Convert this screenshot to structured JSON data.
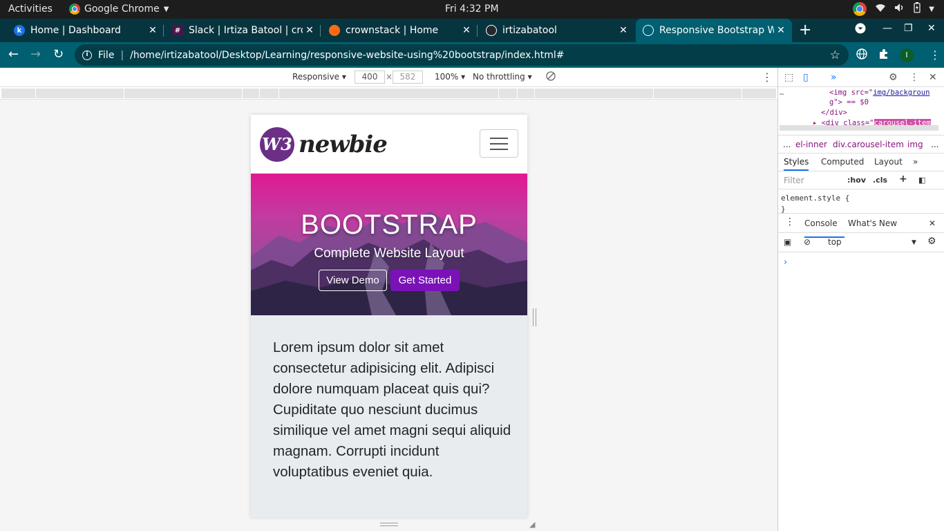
{
  "system": {
    "activities": "Activities",
    "app_name": "Google Chrome",
    "clock": "Fri  4:32 PM"
  },
  "tabs": [
    {
      "title": "Home | Dashboard",
      "favicon_letter": "k",
      "favicon_color": "#1a73e8"
    },
    {
      "title": "Slack | Irtiza Batool | crownstack",
      "favicon_letter": "#",
      "favicon_color": "#4a154b"
    },
    {
      "title": "crownstack | Home",
      "favicon_letter": "",
      "favicon_color": "#ff6a13"
    },
    {
      "title": "irtizabatool",
      "favicon_letter": "",
      "favicon_color": "#24292e"
    },
    {
      "title": "Responsive Bootstrap Website",
      "favicon_letter": "",
      "favicon_color": "#005f70"
    }
  ],
  "address": {
    "scheme": "File",
    "url": "/home/irtizabatool/Desktop/Learning/responsive-website-using%20bootstrap/index.html#",
    "profile_initial": "I"
  },
  "device_toolbar": {
    "mode": "Responsive",
    "width": "400",
    "height": "582",
    "times": "×",
    "zoom": "100%",
    "throttling": "No throttling"
  },
  "site": {
    "logo_mark": "W3",
    "logo_text": "newbie",
    "hero_title": "BOOTSTRAP",
    "hero_subtitle": "Complete Website Layout",
    "btn_view_demo": "View Demo",
    "btn_get_started": "Get Started",
    "body_text": "Lorem ipsum dolor sit amet consectetur adipisicing elit. Adipisci dolore numquam placeat quis qui? Cupiditate quo nesciunt ducimus similique vel amet magni sequi aliquid magnam. Corrupti incidunt voluptatibus eveniet quia."
  },
  "devtools": {
    "elements_line1_tag": "<img src=\"",
    "elements_line1_link": "img/backgroun",
    "elements_line2": "g\"> == $0",
    "elements_line3": "</div>",
    "elements_line4": "▸ <div class=\"",
    "elements_line4_hl": "carousel-item",
    "crumb_more": "...",
    "crumb_1": "el-inner",
    "crumb_2": "div.carousel-item",
    "crumb_3": "img",
    "crumb_end": "...",
    "tab_styles": "Styles",
    "tab_computed": "Computed",
    "tab_layout": "Layout",
    "tab_more": "»",
    "filter_placeholder": "Filter",
    "hov": ":hov",
    "cls": ".cls",
    "style_line1": "element.style {",
    "style_line2": "}",
    "drawer_console": "Console",
    "drawer_whats_new": "What's New",
    "context": "top",
    "prompt": "›"
  }
}
